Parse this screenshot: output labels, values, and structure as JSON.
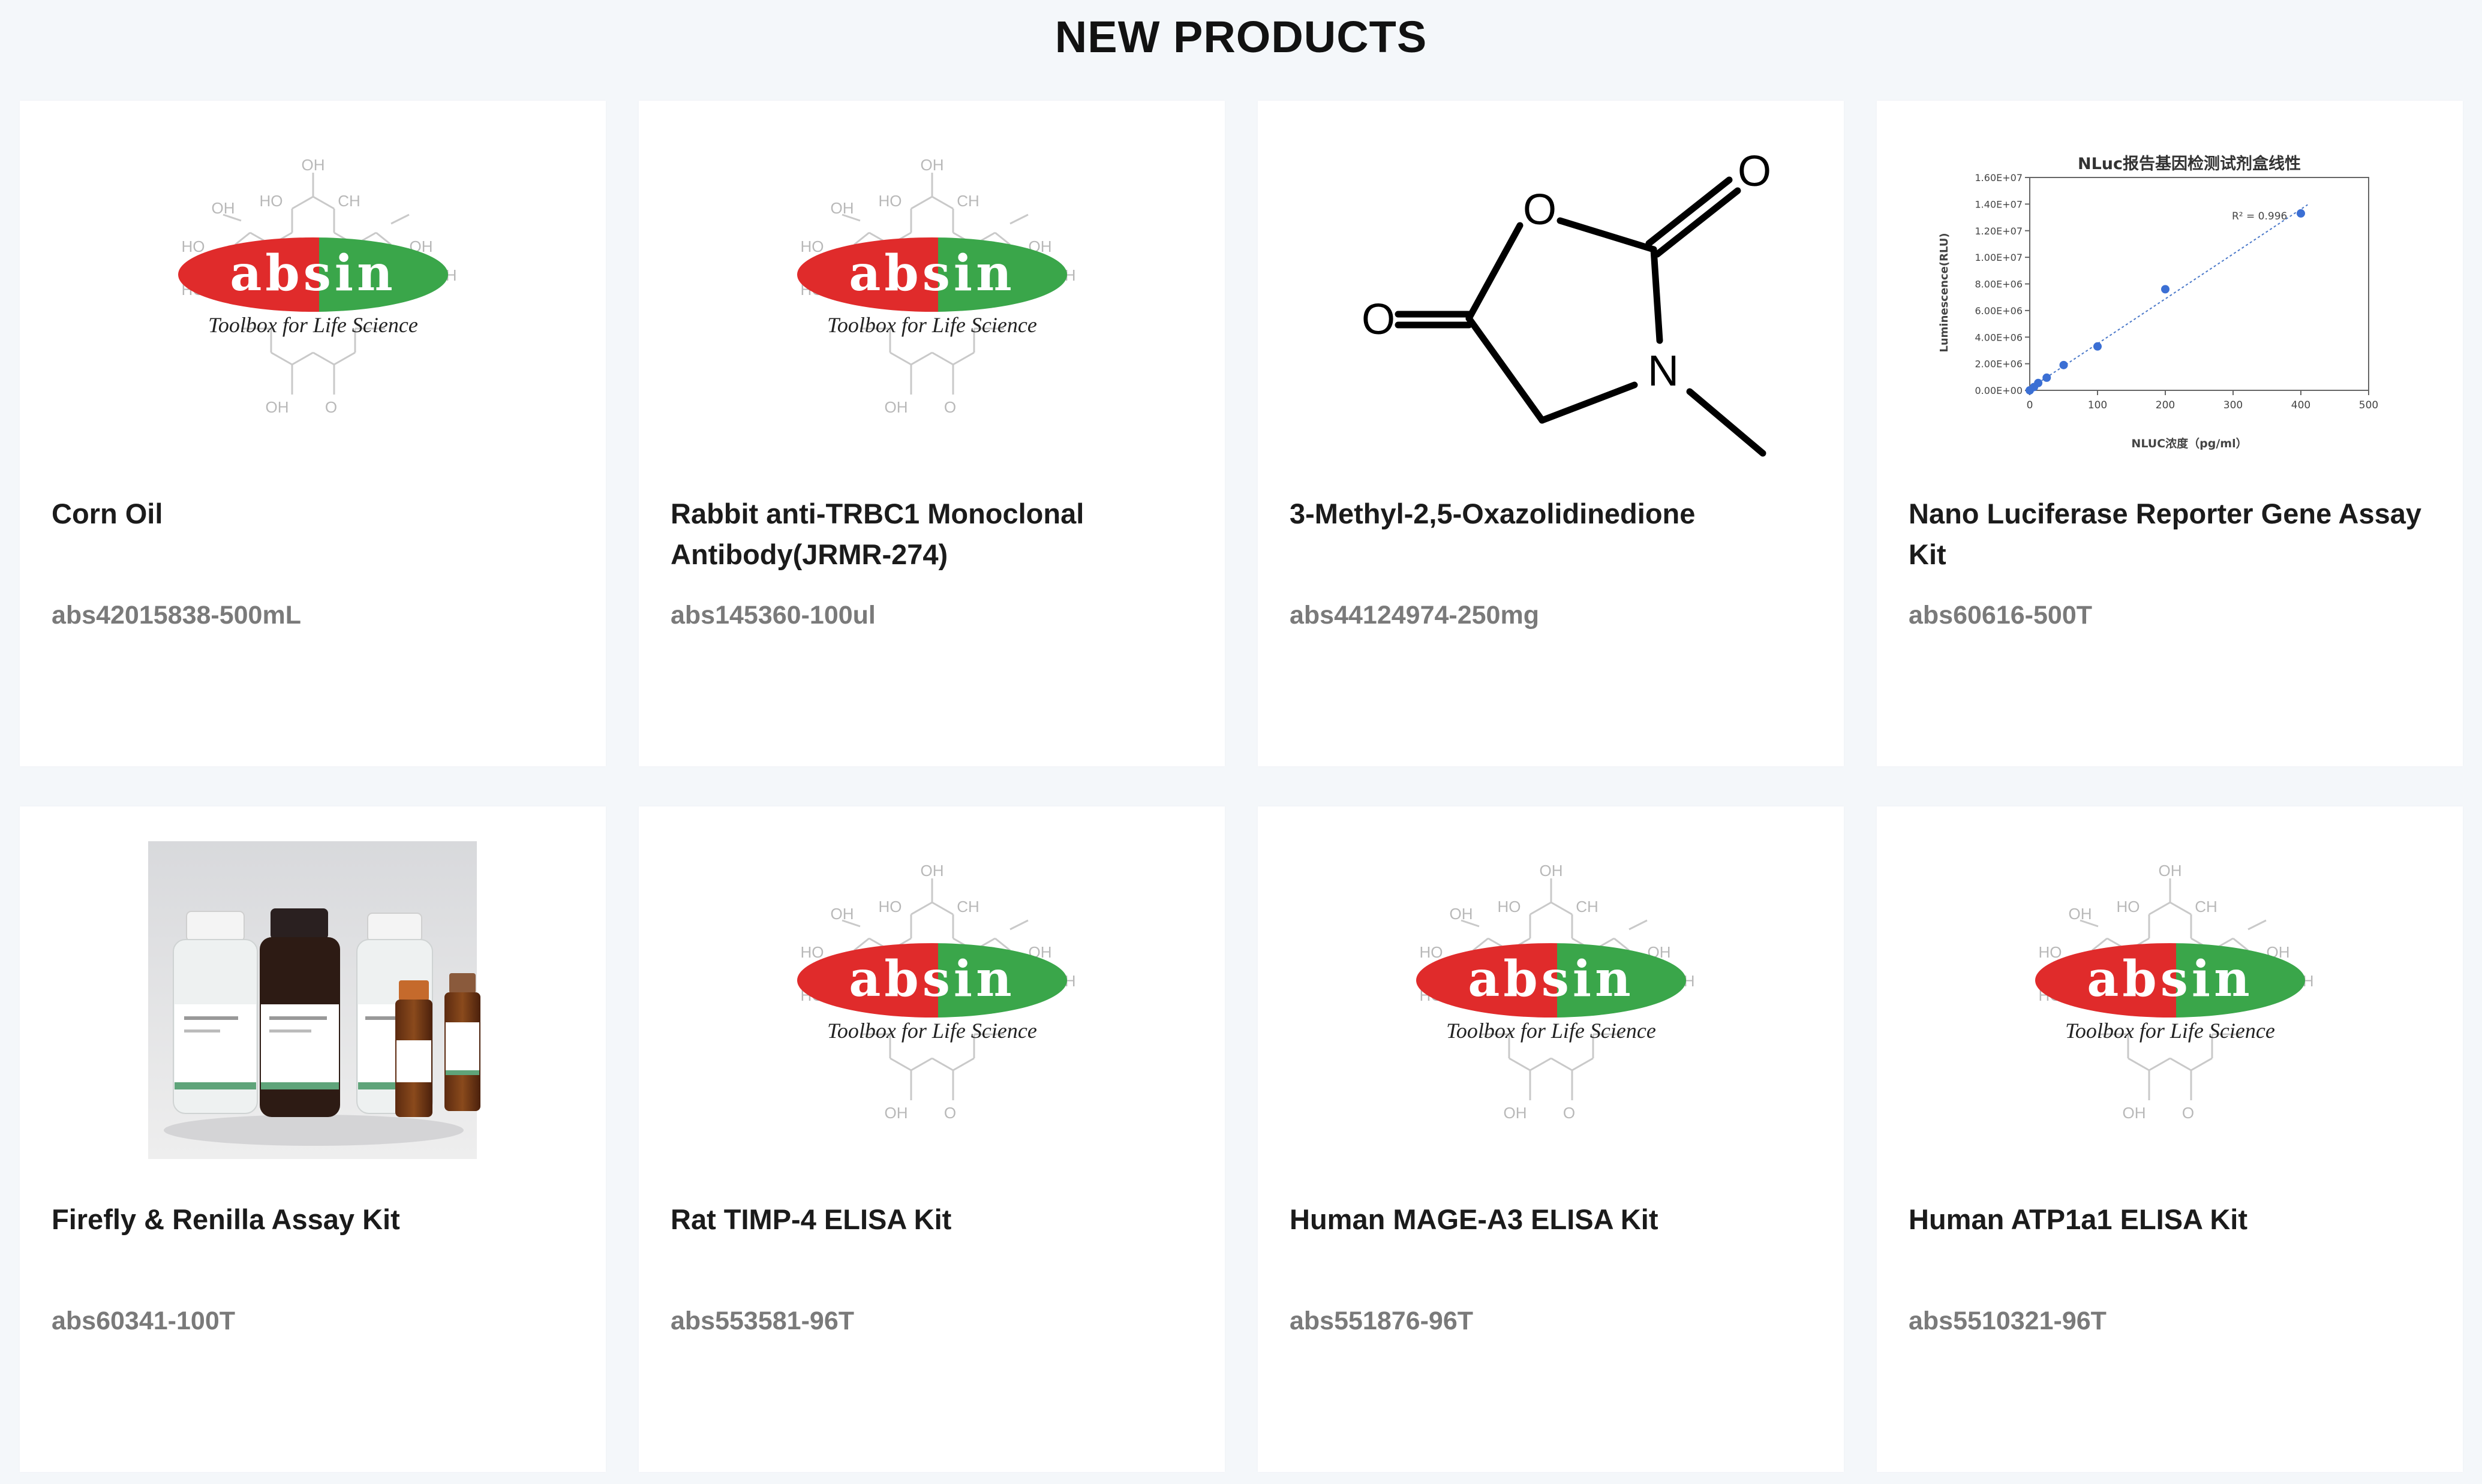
{
  "page": {
    "title": "NEW PRODUCTS"
  },
  "colors": {
    "background": "#f4f7fa",
    "card": "#ffffff",
    "logo_red": "#e02b2b",
    "logo_green": "#3aa64a",
    "sku_gray": "#7a7a7a"
  },
  "logo": {
    "word": "absin",
    "tagline": "Toolbox for Life Science"
  },
  "products": [
    {
      "name": "Corn Oil",
      "sku": "abs42015838-500mL",
      "image": "absin-logo"
    },
    {
      "name": "Rabbit anti-TRBC1 Monoclonal Antibody(JRMR-274)",
      "sku": "abs145360-100ul",
      "image": "absin-logo"
    },
    {
      "name": "3-Methyl-2,5-Oxazolidinedione",
      "sku": "abs44124974-250mg",
      "image": "chemical-structure"
    },
    {
      "name": "Nano Luciferase Reporter Gene Assay Kit",
      "sku": "abs60616-500T",
      "image": "standard-curve-chart"
    },
    {
      "name": "Firefly & Renilla Assay Kit",
      "sku": "abs60341-100T",
      "image": "kit-bottles-photo"
    },
    {
      "name": "Rat TIMP-4 ELISA Kit",
      "sku": "abs553581-96T",
      "image": "absin-logo"
    },
    {
      "name": "Human MAGE-A3 ELISA Kit",
      "sku": "abs551876-96T",
      "image": "absin-logo"
    },
    {
      "name": "Human ATP1a1 ELISA Kit",
      "sku": "abs5510321-96T",
      "image": "absin-logo"
    }
  ],
  "molecule": {
    "atoms": [
      "O",
      "O",
      "O",
      "N"
    ]
  },
  "nluc_chart": {
    "title": "NLuc报告基因检测试剂盒线性",
    "ylabel": "Luminescence(RLU)",
    "xlabel": "NLUC浓度（pg/ml）",
    "annotation": "R² = 0.996",
    "y_ticks": [
      "0.00E+00",
      "2.00E+06",
      "4.00E+06",
      "6.00E+06",
      "8.00E+06",
      "1.00E+07",
      "1.20E+07",
      "1.40E+07",
      "1.60E+07"
    ],
    "x_ticks": [
      "0",
      "100",
      "200",
      "300",
      "400",
      "500"
    ]
  },
  "chart_data": {
    "type": "scatter",
    "title": "NLuc报告基因检测试剂盒线性",
    "xlabel": "NLUC浓度（pg/ml）",
    "ylabel": "Luminescence(RLU)",
    "xlim": [
      0,
      500
    ],
    "ylim": [
      0,
      16000000
    ],
    "x": [
      0,
      6.25,
      12.5,
      25,
      50,
      100,
      200,
      400
    ],
    "y": [
      0,
      250000,
      550000,
      950000,
      1900000,
      3300000,
      7600000,
      13300000
    ],
    "trendline": "linear",
    "annotation": "R² = 0.996",
    "grid": false
  }
}
